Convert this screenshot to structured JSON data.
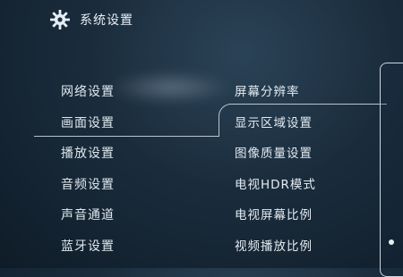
{
  "header": {
    "title": "系统设置",
    "icon": "gear-icon"
  },
  "left_menu": {
    "items": [
      {
        "label": "网络设置"
      },
      {
        "label": "画面设置"
      },
      {
        "label": "播放设置"
      },
      {
        "label": "音频设置"
      },
      {
        "label": "声音通道"
      },
      {
        "label": "蓝牙设置"
      }
    ],
    "selected_index": 1
  },
  "right_menu": {
    "items": [
      {
        "label": "屏幕分辨率"
      },
      {
        "label": "显示区域设置"
      },
      {
        "label": "图像质量设置"
      },
      {
        "label": "电视HDR模式"
      },
      {
        "label": "电视屏幕比例"
      },
      {
        "label": "视频播放比例"
      }
    ]
  },
  "colors": {
    "background": "#1a2c3c",
    "text": "#e6eef5",
    "divider": "#c9d6e0"
  }
}
